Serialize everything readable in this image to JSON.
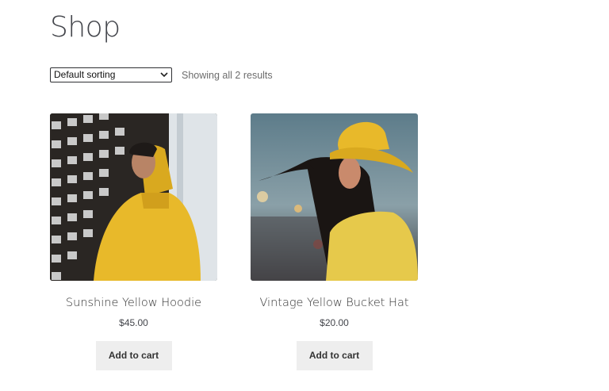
{
  "page": {
    "title": "Shop"
  },
  "toolbar": {
    "sort_selected": "Default sorting",
    "result_count": "Showing all 2 results"
  },
  "products": [
    {
      "name": "Sunshine Yellow Hoodie",
      "price": "$45.00",
      "button": "Add to cart"
    },
    {
      "name": "Vintage Yellow Bucket Hat",
      "price": "$20.00",
      "button": "Add to cart"
    }
  ],
  "colors": {
    "accent_yellow": "#e8b92a",
    "button_bg": "#eeeeee",
    "text": "#43454b"
  }
}
